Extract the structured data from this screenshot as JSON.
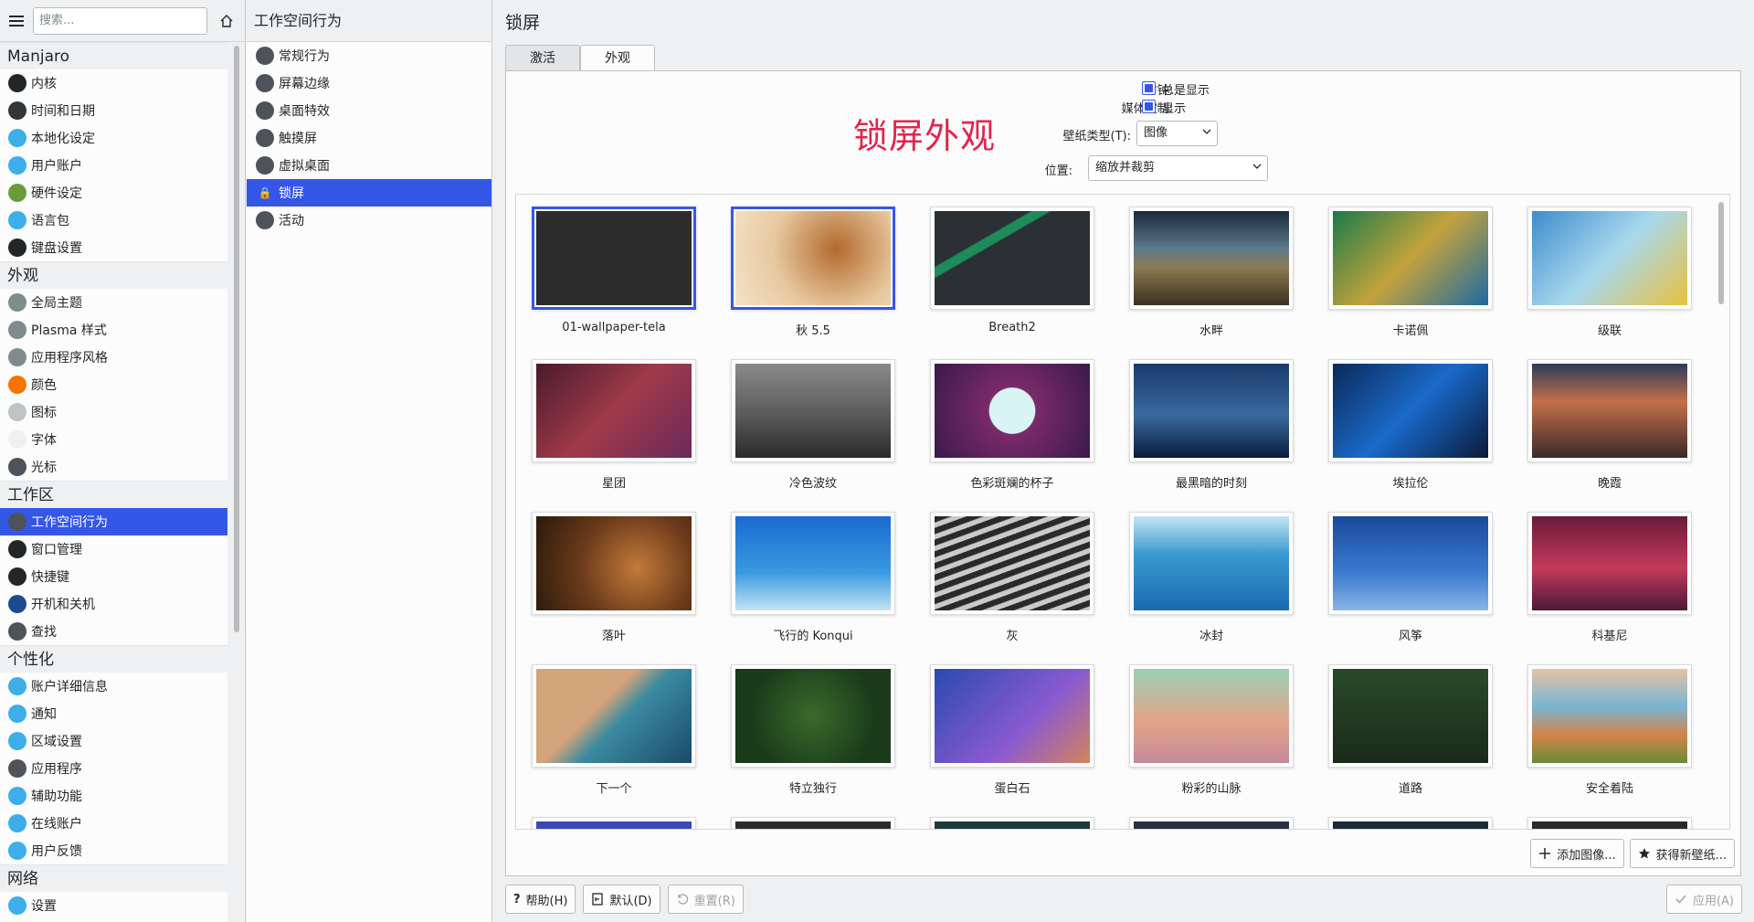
{
  "left": {
    "search_placeholder": "搜索...",
    "groups": [
      {
        "title": "Manjaro",
        "items": [
          {
            "label": "内核",
            "icon": "gears-icon",
            "color": "#232629"
          },
          {
            "label": "时间和日期",
            "icon": "clock-icon",
            "color": "#31363b"
          },
          {
            "label": "本地化设定",
            "icon": "locale-icon",
            "color": "#3daee9"
          },
          {
            "label": "用户账户",
            "icon": "user-icon",
            "color": "#3daee9"
          },
          {
            "label": "硬件设定",
            "icon": "hardware-icon",
            "color": "#6a9b3a"
          },
          {
            "label": "语言包",
            "icon": "language-icon",
            "color": "#3daee9"
          },
          {
            "label": "键盘设置",
            "icon": "keyboard-icon",
            "color": "#232629"
          }
        ]
      },
      {
        "title": "外观",
        "items": [
          {
            "label": "全局主题",
            "icon": "global-theme-icon",
            "color": "#7f8c8d"
          },
          {
            "label": "Plasma 样式",
            "icon": "plasma-style-icon",
            "color": "#7f8c8d"
          },
          {
            "label": "应用程序风格",
            "icon": "app-style-icon",
            "color": "#7f8c8d"
          },
          {
            "label": "颜色",
            "icon": "colors-icon",
            "color": "#f67400"
          },
          {
            "label": "图标",
            "icon": "icons-icon",
            "color": "#bdc3c7"
          },
          {
            "label": "字体",
            "icon": "fonts-icon",
            "color": "#eff0f1"
          },
          {
            "label": "光标",
            "icon": "cursor-icon",
            "color": "#4d5358"
          }
        ]
      },
      {
        "title": "工作区",
        "items": [
          {
            "label": "工作空间行为",
            "icon": "workspace-icon",
            "color": "#4d5358",
            "selected": true
          },
          {
            "label": "窗口管理",
            "icon": "window-icon",
            "color": "#232629"
          },
          {
            "label": "快捷键",
            "icon": "shortcuts-icon",
            "color": "#232629"
          },
          {
            "label": "开机和关机",
            "icon": "startup-icon",
            "color": "#1d4a8f"
          },
          {
            "label": "查找",
            "icon": "search-icon",
            "color": "#4d5358"
          }
        ]
      },
      {
        "title": "个性化",
        "items": [
          {
            "label": "账户详细信息",
            "icon": "account-icon",
            "color": "#3daee9"
          },
          {
            "label": "通知",
            "icon": "notification-icon",
            "color": "#3daee9"
          },
          {
            "label": "区域设置",
            "icon": "region-icon",
            "color": "#3daee9"
          },
          {
            "label": "应用程序",
            "icon": "applications-icon",
            "color": "#4d5358"
          },
          {
            "label": "辅助功能",
            "icon": "accessibility-icon",
            "color": "#3daee9"
          },
          {
            "label": "在线账户",
            "icon": "online-accounts-icon",
            "color": "#3daee9"
          },
          {
            "label": "用户反馈",
            "icon": "feedback-icon",
            "color": "#3daee9"
          }
        ]
      },
      {
        "title": "网络",
        "items": [
          {
            "label": "设置",
            "icon": "network-settings-icon",
            "color": "#3daee9"
          }
        ]
      }
    ]
  },
  "mid": {
    "title": "工作空间行为",
    "items": [
      {
        "label": "常规行为",
        "icon": "general-behavior-icon"
      },
      {
        "label": "屏幕边缘",
        "icon": "screen-edges-icon"
      },
      {
        "label": "桌面特效",
        "icon": "desktop-effects-icon"
      },
      {
        "label": "触摸屏",
        "icon": "touchscreen-icon"
      },
      {
        "label": "虚拟桌面",
        "icon": "virtual-desktops-icon"
      },
      {
        "label": "锁屏",
        "icon": "lock-icon",
        "selected": true
      },
      {
        "label": "活动",
        "icon": "activities-icon"
      }
    ]
  },
  "right": {
    "title": "锁屏",
    "tabs": [
      "激活",
      "外观"
    ],
    "active_tab": "外观",
    "overlay_title": "锁屏外观",
    "clock_label": "时钟:",
    "clock_option": "总是显示",
    "media_label": "媒体控制:",
    "media_option": "显示",
    "wallpaper_type_label": "壁纸类型(T):",
    "wallpaper_type_value": "图像",
    "position_label": "位置:",
    "position_value": "缩放并裁剪",
    "wallpapers": [
      {
        "name": "01-wallpaper-tela",
        "bg": "linear-gradient(135deg,#2c2c2c,#2c2c2c)",
        "selected": true
      },
      {
        "name": "秋 5.5",
        "bg": "radial-gradient(circle at 65% 40%,#b36a2e,#e8c9a0 55%,#f3e3c7)",
        "selected": true
      },
      {
        "name": "Breath2",
        "bg": "linear-gradient(150deg,#2b3034 30%,#1e8c5a 31%,#1e8c5a 36%,#2b3034 37%)"
      },
      {
        "name": "水畔",
        "bg": "linear-gradient(180deg,#1a2a3a,#5d7a8a 40%,#8a7a50 60%,#3a3020)"
      },
      {
        "name": "卡诺佩",
        "bg": "linear-gradient(135deg,#1a7a4a,#c4a33c 50%,#1e6aa0)"
      },
      {
        "name": "级联",
        "bg": "linear-gradient(135deg,#3d8ccc,#a8d8ee 50%,#e9c13c)"
      },
      {
        "name": "星团",
        "bg": "linear-gradient(135deg,#4a1a2a,#a03a4a 50%,#6a2a5a)"
      },
      {
        "name": "冷色波纹",
        "bg": "linear-gradient(180deg,#8a8a8a,#5a5a5a 55%,#2a2a2a)"
      },
      {
        "name": "色彩斑斓的杯子",
        "bg": "radial-gradient(circle,#d8f4f4 25%,#7a2a6a 26%,#3a1a4a)"
      },
      {
        "name": "最黑暗的时刻",
        "bg": "linear-gradient(180deg,#1a3a6a,#3a6aa0 55%,#0a1a3a)"
      },
      {
        "name": "埃拉伦",
        "bg": "linear-gradient(135deg,#0a2a5a,#1a6aca 50%,#0a1a3a)"
      },
      {
        "name": "晚霞",
        "bg": "linear-gradient(180deg,#2a3a5a,#c4704a 40%,#3a2a2a)"
      },
      {
        "name": "落叶",
        "bg": "radial-gradient(circle at 65% 55%,#c47a3a,#6a3a1a 50%,#2a1a0a)"
      },
      {
        "name": "飞行的 Konqui",
        "bg": "linear-gradient(180deg,#1a6ad0,#3a9ae0 60%,#c4e4f4)"
      },
      {
        "name": "灰",
        "bg": "repeating-linear-gradient(160deg,#2a2a2a 0 6px,#cacaca 7px 12px)"
      },
      {
        "name": "冰封",
        "bg": "linear-gradient(180deg,#c4e4f4,#3a9ad0 40%,#1a6ab0)"
      },
      {
        "name": "风筝",
        "bg": "linear-gradient(180deg,#1a4a9a,#3a7ad0 60%,#8ab4e4)"
      },
      {
        "name": "科基尼",
        "bg": "linear-gradient(180deg,#6a1a3a,#c43a5a 55%,#4a1a3a)"
      },
      {
        "name": "下一个",
        "bg": "linear-gradient(135deg,#d4a47a 40%,#3a8aa0 55%,#1a4a6a)"
      },
      {
        "name": "特立独行",
        "bg": "radial-gradient(circle,#3a6a2a,#1a3a1a 70%)"
      },
      {
        "name": "蛋白石",
        "bg": "linear-gradient(135deg,#2a4ab0,#8a5ad0 60%,#d4845a)"
      },
      {
        "name": "粉彩的山脉",
        "bg": "linear-gradient(180deg,#9ad0b4,#e4a48a 55%,#c48a9a)"
      },
      {
        "name": "道路",
        "bg": "linear-gradient(180deg,#2a4a2a,#1a2a1a)"
      },
      {
        "name": "安全着陆",
        "bg": "linear-gradient(180deg,#e4c4a4,#7ab4d4 40%,#d4844a 70%,#6a8a3a)"
      }
    ],
    "add_image_label": "添加图像...",
    "get_new_label": "获得新壁纸...",
    "help_label": "帮助(H)",
    "default_label": "默认(D)",
    "reset_label": "重置(R)",
    "apply_label": "应用(A)"
  }
}
